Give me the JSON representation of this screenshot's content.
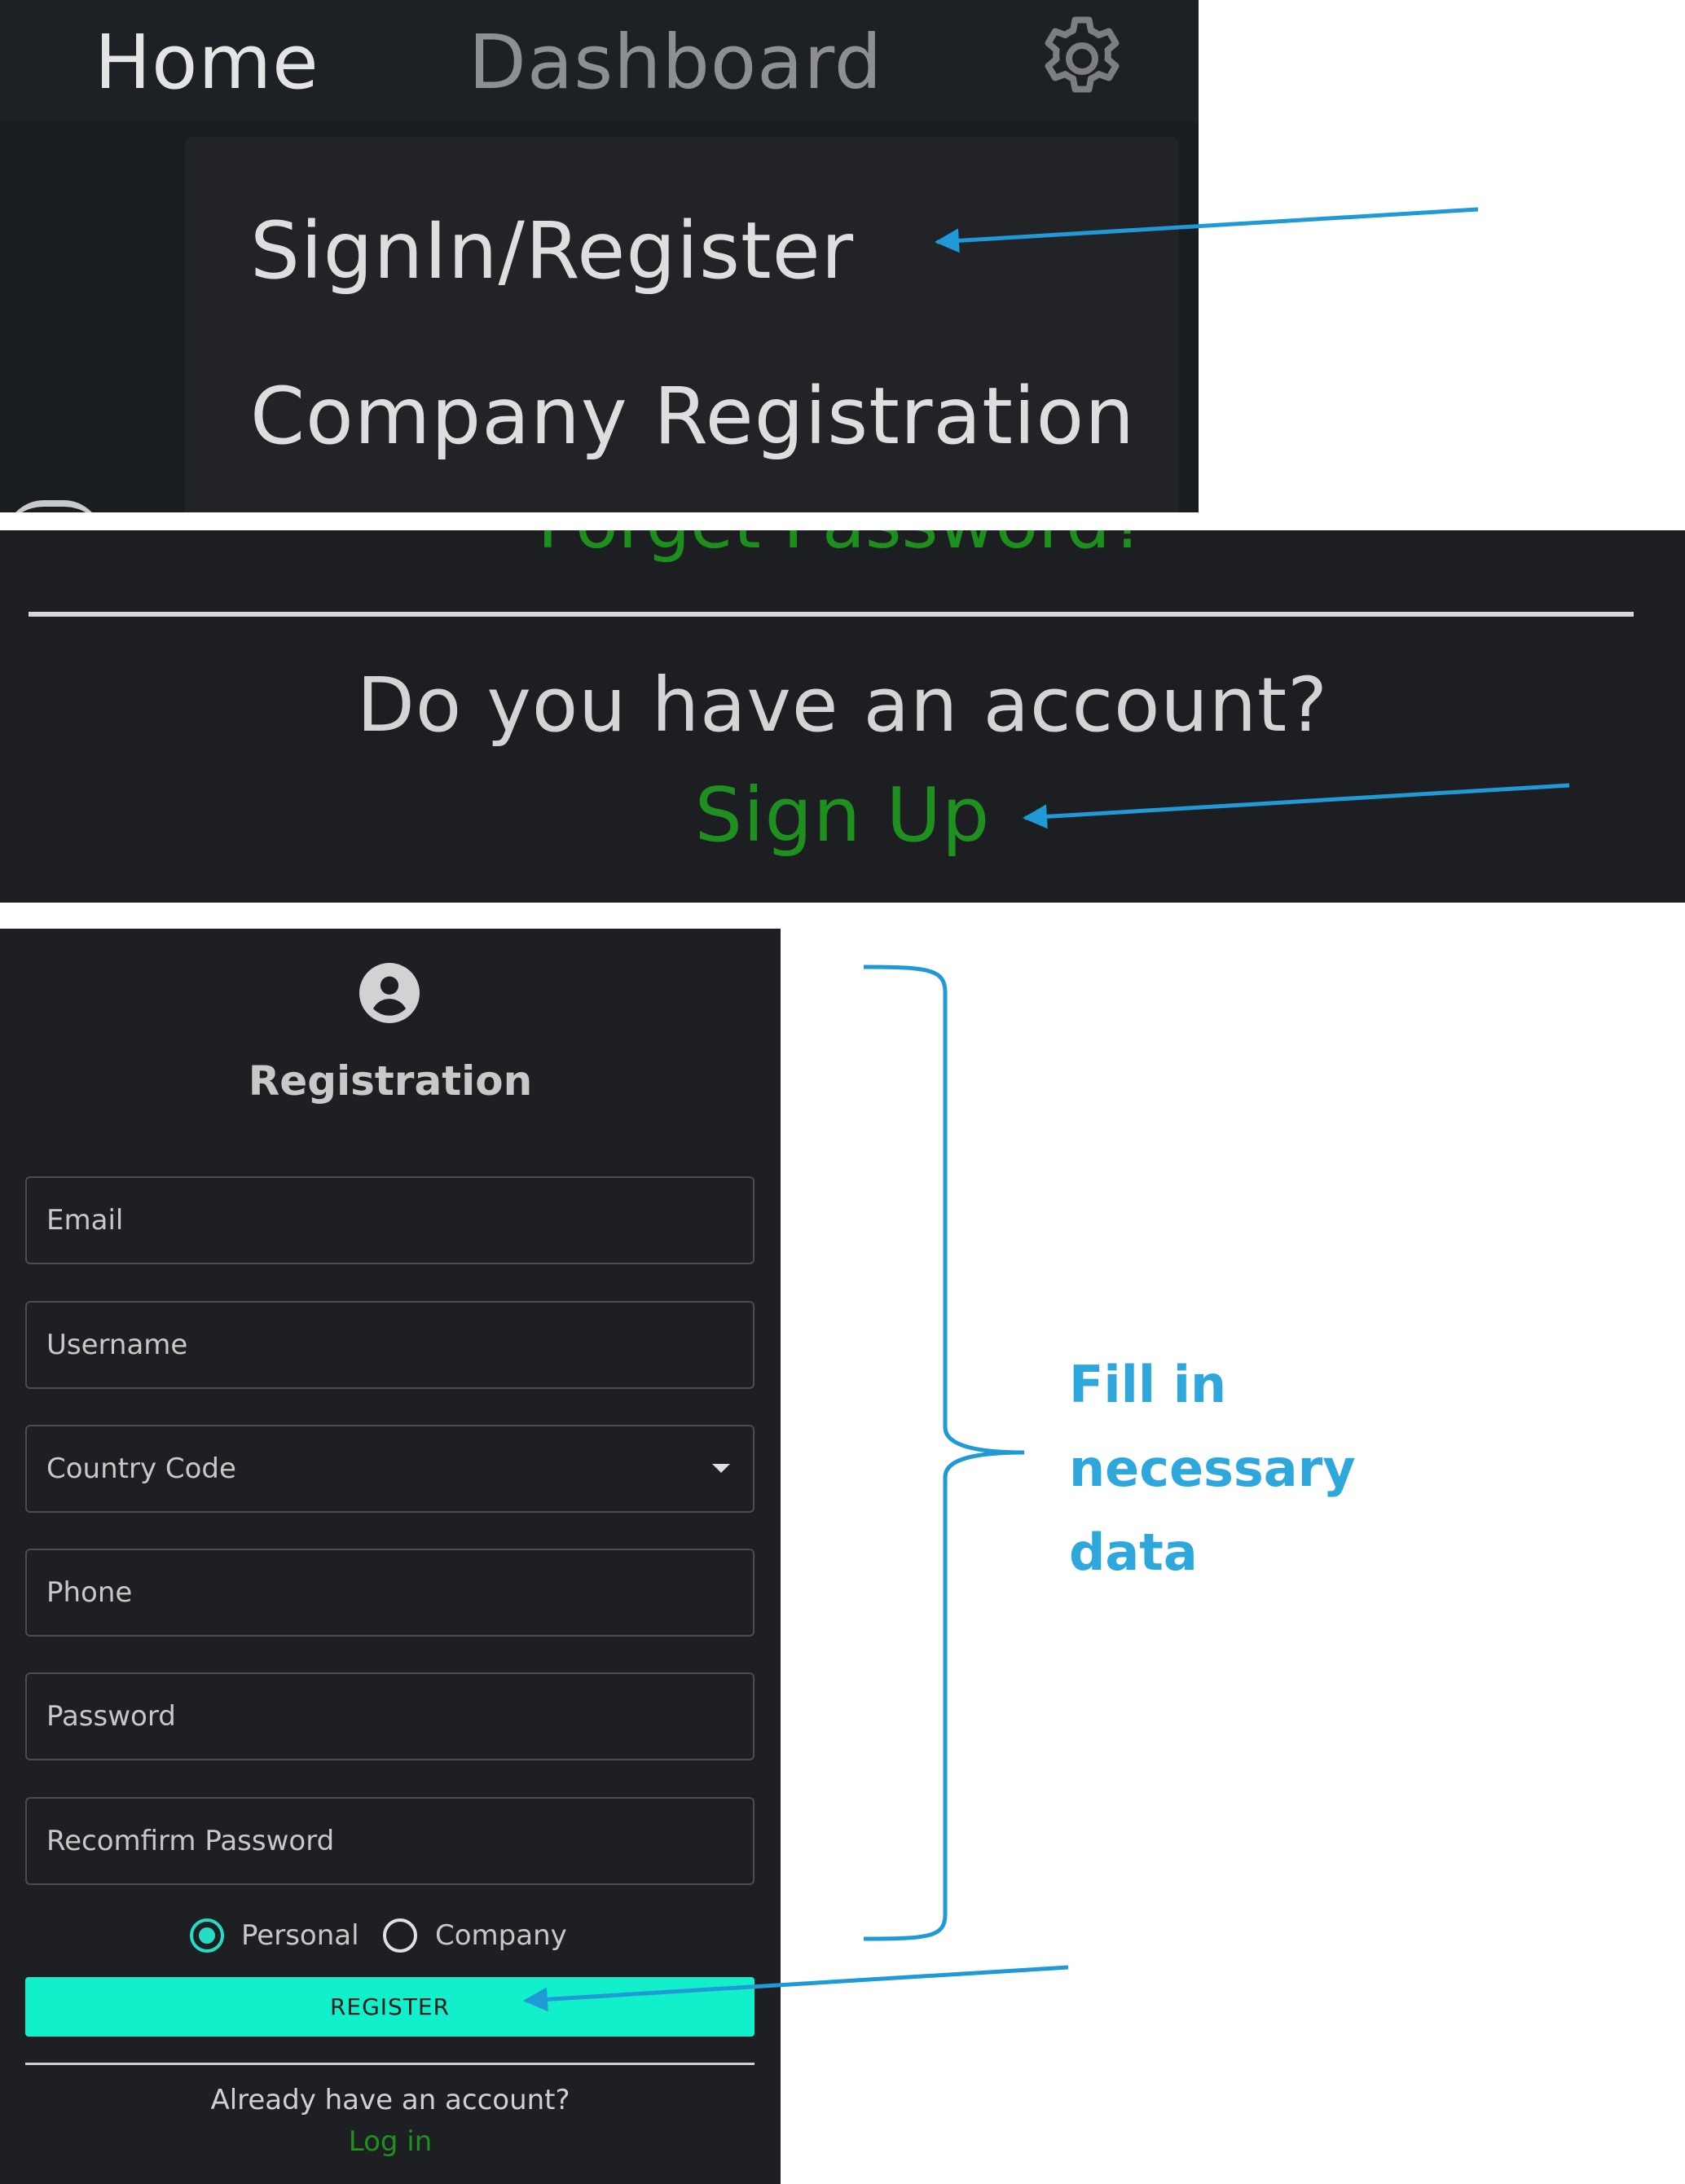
{
  "nav": {
    "home": "Home",
    "dashboard": "Dashboard",
    "settings_icon": "gear-icon",
    "menu": [
      "SignIn/Register",
      "Company Registration"
    ]
  },
  "signin_footer": {
    "forgot_partial": "Forget Password?",
    "question": "Do you have an account?",
    "signup": "Sign Up"
  },
  "registration": {
    "icon": "user-avatar-icon",
    "title": "Registration",
    "fields": {
      "email": "Email",
      "username": "Username",
      "country_code": "Country Code",
      "phone": "Phone",
      "password": "Password",
      "reconfirm": "Recomfirm Password"
    },
    "account_type": {
      "options": [
        "Personal",
        "Company"
      ],
      "selected": "Personal"
    },
    "register_button": "REGISTER",
    "already": "Already have an account?",
    "login": "Log in"
  },
  "annotation": {
    "lines": [
      "Fill in",
      "necessary",
      "data"
    ],
    "color": "#2ea8dc"
  },
  "colors": {
    "accent_teal": "#12efcb",
    "link_green": "#1f8f1f",
    "panel_dark": "#1e1f22"
  }
}
